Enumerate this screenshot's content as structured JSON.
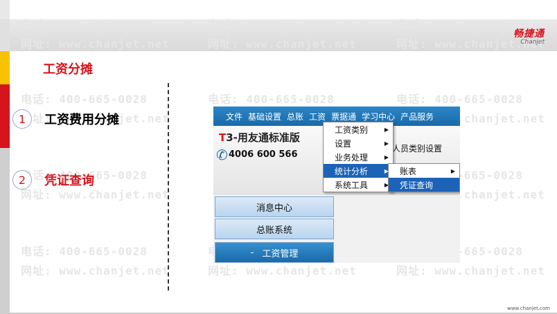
{
  "brand": {
    "logo_cn": "畅捷通",
    "logo_en": "Chanjet"
  },
  "watermark": {
    "phone": "电话: 400-665-0028",
    "site": "网址: www.chanjet.net"
  },
  "section_title": "工资分摊",
  "steps": [
    {
      "num": "1",
      "label": "工资费用分摊",
      "color": "#000000"
    },
    {
      "num": "2",
      "label": "凭证查询",
      "color": "#d6141d"
    }
  ],
  "app": {
    "menubar": [
      "文件",
      "基础设置",
      "总账",
      "工资",
      "票据通",
      "学习中心",
      "产品服务"
    ],
    "banner_title_t": "T",
    "banner_title": "3-用友通标准版",
    "phone": "4006 600 566",
    "extra_label": "人员类别设置",
    "nav": [
      "消息中心",
      "总账系统",
      "工资管理"
    ],
    "nav_active_prefix": "-",
    "menu1": [
      "工资类别",
      "设置",
      "业务处理",
      "统计分析",
      "系统工具"
    ],
    "menu2": [
      "账表",
      "凭证查询"
    ]
  },
  "footer_url": "www.chanjet.com",
  "colors": {
    "accent": "#d6141d",
    "menubar": "#1a6aa8",
    "highlight": "#1c63b8"
  }
}
